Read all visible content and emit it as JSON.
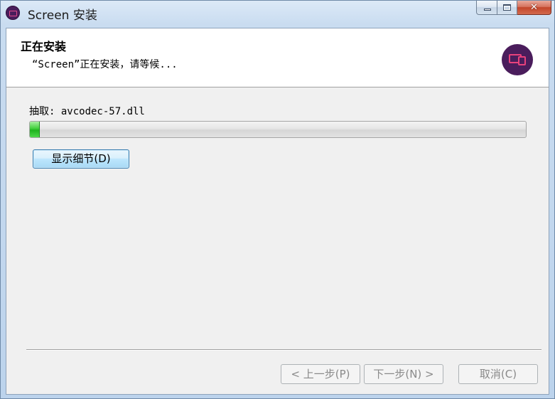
{
  "window": {
    "title": "Screen 安装",
    "caption_close": "✕"
  },
  "header": {
    "title": "正在安装",
    "subtitle": "“Screen”正在安装，请等候..."
  },
  "body": {
    "extract_label": "抽取: avcodec-57.dll",
    "progress": 0.02,
    "show_details_label": "显示细节(D)"
  },
  "footer": {
    "back_label": "< 上一步(P)",
    "next_label": "下一步(N) >",
    "cancel_label": "取消(C)"
  },
  "colors": {
    "accent_logo_bg": "#4a1d5c",
    "accent_logo_fg": "#e8427c",
    "progress_green": "#1fb21e"
  },
  "icons": {
    "app": "screen-app-icon",
    "logo": "screen-logo-icon"
  }
}
